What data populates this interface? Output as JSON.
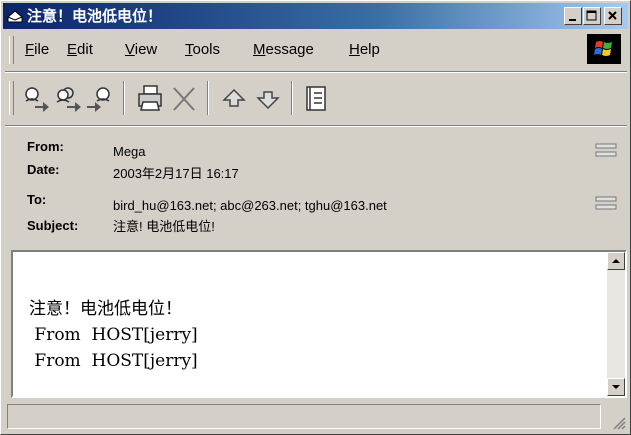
{
  "window": {
    "title": "注意！电池低电位！",
    "controls": [
      "minimize",
      "maximize",
      "close"
    ]
  },
  "menu": {
    "items": [
      {
        "id": "file",
        "mnemonic": "F",
        "rest": "ile"
      },
      {
        "id": "edit",
        "mnemonic": "E",
        "rest": "dit"
      },
      {
        "id": "view",
        "mnemonic": "V",
        "rest": "iew"
      },
      {
        "id": "tools",
        "mnemonic": "T",
        "rest": "ools"
      },
      {
        "id": "message",
        "mnemonic": "M",
        "rest": "essage"
      },
      {
        "id": "help",
        "mnemonic": "H",
        "rest": "elp"
      }
    ]
  },
  "toolbar": {
    "buttons": [
      "reply-icon",
      "reply-all-icon",
      "forward-icon",
      "print-icon",
      "delete-icon",
      "previous-icon",
      "next-icon",
      "address-book-icon"
    ]
  },
  "headers": {
    "from_label": "From:",
    "from_value": "Mega",
    "date_label": "Date:",
    "date_value": "2003年2月17日 16:17",
    "to_label": "To:",
    "to_value": "bird_hu@163.net; abc@263.net; tghu@163.net",
    "subject_label": "Subject:",
    "subject_value": "注意! 电池低电位!"
  },
  "body": {
    "lines": [
      "注意！电池低电位！",
      " From  HOST[jerry]",
      " From  HOST[jerry]"
    ]
  },
  "colors": {
    "titlebar_start": "#0a246a",
    "titlebar_end": "#a6caf0",
    "chrome": "#d4d0c8"
  }
}
